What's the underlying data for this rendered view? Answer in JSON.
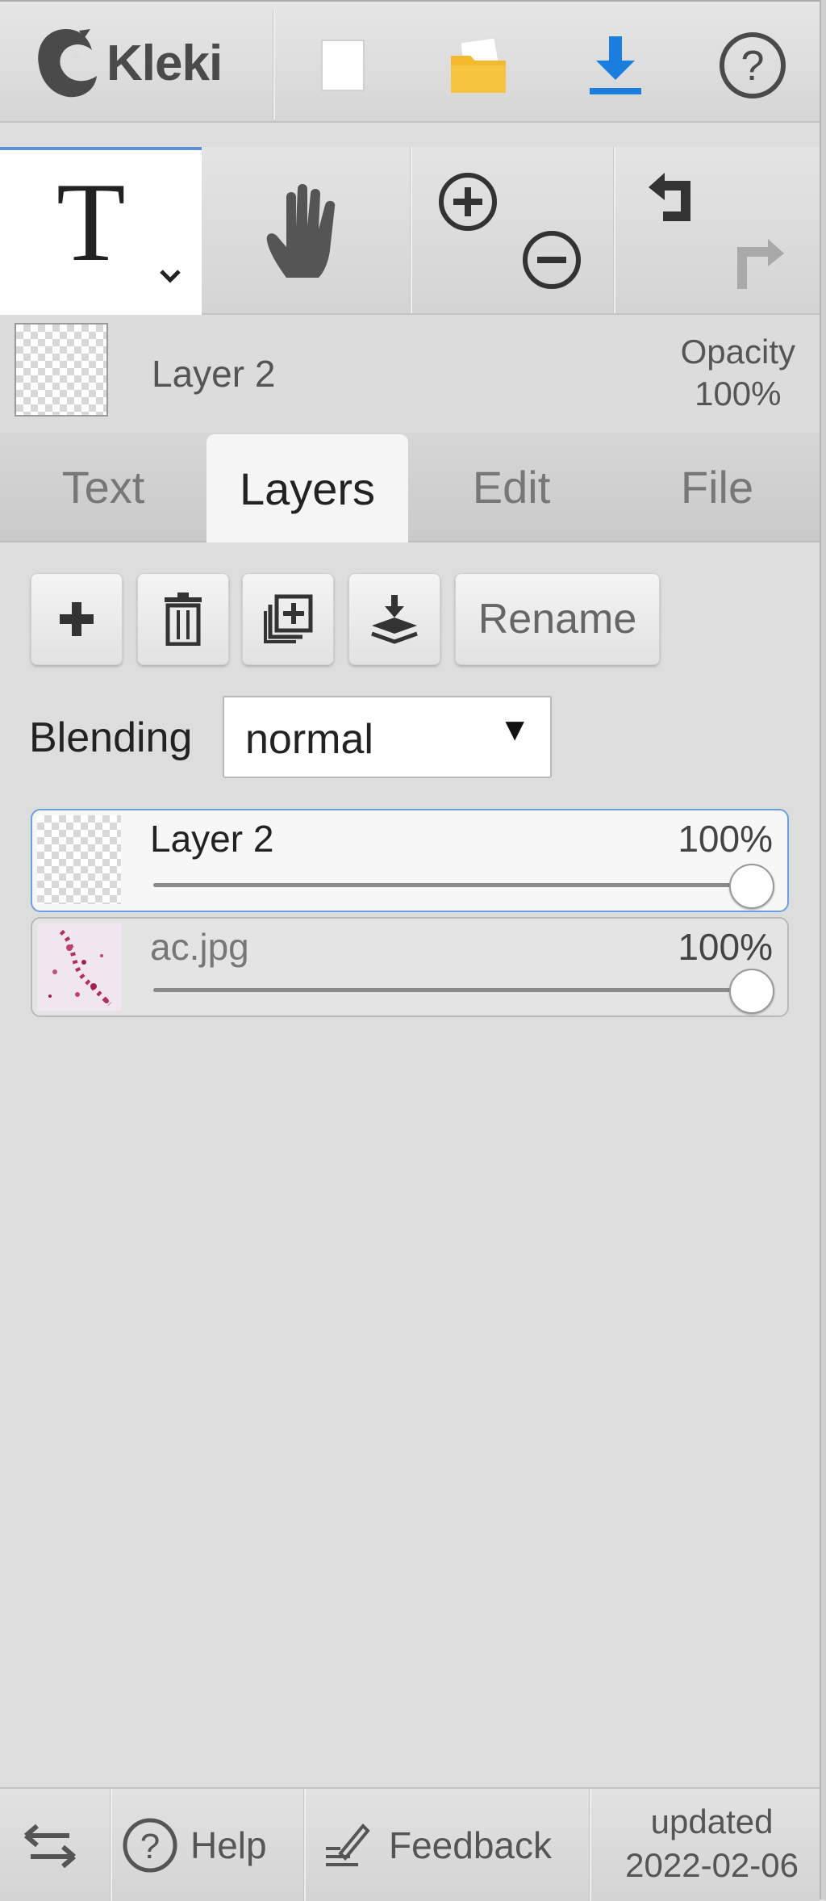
{
  "app": {
    "name": "Kleki"
  },
  "toolbar": {
    "new_icon": "new-document-icon",
    "open_icon": "folder-icon",
    "save_icon": "download-icon",
    "help_icon": "question-icon"
  },
  "tools": {
    "active_tool": "T",
    "hand_icon": "hand-icon",
    "zoom_in_icon": "zoom-in-icon",
    "zoom_out_icon": "zoom-out-icon",
    "undo_icon": "undo-icon",
    "redo_icon": "redo-icon"
  },
  "current_layer": {
    "name": "Layer 2",
    "opacity_label": "Opacity",
    "opacity_value": "100%"
  },
  "tabs": [
    {
      "label": "Text",
      "active": false
    },
    {
      "label": "Layers",
      "active": true
    },
    {
      "label": "Edit",
      "active": false
    },
    {
      "label": "File",
      "active": false
    }
  ],
  "layers_panel": {
    "rename_label": "Rename",
    "blending_label": "Blending",
    "blending_value": "normal",
    "layers": [
      {
        "name": "Layer 2",
        "opacity": "100%",
        "opacity_fraction": 1.0,
        "selected": true
      },
      {
        "name": "ac.jpg",
        "opacity": "100%",
        "opacity_fraction": 1.0,
        "selected": false
      }
    ]
  },
  "bottom": {
    "help_label": "Help",
    "feedback_label": "Feedback",
    "updated_label": "updated",
    "updated_date": "2022-02-06"
  },
  "colors": {
    "accent": "#5b8fd6",
    "download_blue": "#1a7ee0",
    "folder_yellow": "#f3b92c"
  }
}
